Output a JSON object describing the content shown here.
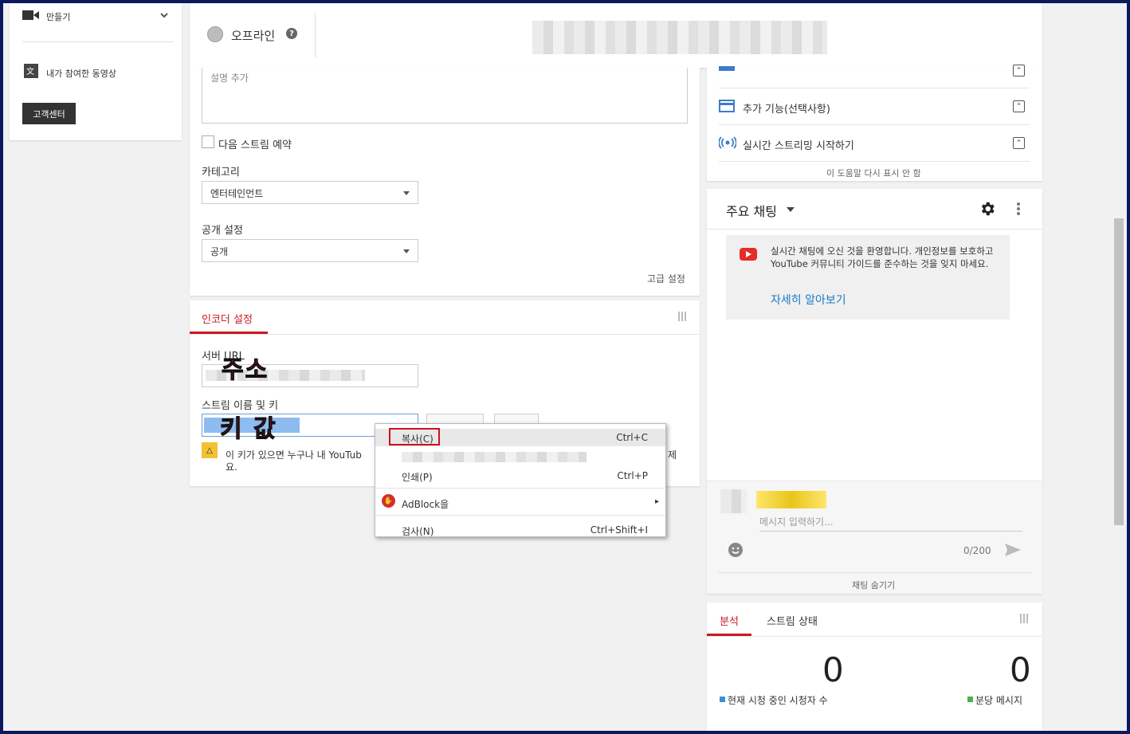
{
  "sidebar": {
    "create_label": "만들기",
    "contributed_label": "내가 참여한 동영상",
    "support_button": "고객센터"
  },
  "topbar": {
    "status": "오프라인",
    "help_icon": "?"
  },
  "info": {
    "description_placeholder": "설명 추가",
    "schedule_next_stream": "다음 스트림 예약",
    "category_label": "카테고리",
    "category_value": "엔터테인먼트",
    "privacy_label": "공개 설정",
    "privacy_value": "공개",
    "advanced_settings": "고급 설정"
  },
  "encoder": {
    "tab": "인코더 설정",
    "server_url_label": "서버 URL",
    "stream_key_label": "스트림 이름 및 키",
    "warning_line1": "이 키가 있으면 누구나 내 YouTub",
    "warning_line2": "요.",
    "warning_tail": "제",
    "overlay_address": "주소",
    "overlay_key": "키 값"
  },
  "context_menu": {
    "items": [
      {
        "label": "복사(C)",
        "shortcut": "Ctrl+C"
      },
      {
        "label": "인쇄(P)",
        "shortcut": "Ctrl+P"
      },
      {
        "label": "AdBlock을",
        "shortcut": "▸"
      },
      {
        "label": "검사(N)",
        "shortcut": "Ctrl+Shift+I"
      }
    ]
  },
  "help_panel": {
    "rows": [
      {
        "label": "추가 기능(선택사항)",
        "icon": "card-icon"
      },
      {
        "label": "실시간 스트리밍 시작하기",
        "icon": "broadcast-icon"
      }
    ],
    "dismiss": "이 도움말 다시 표시 안 함"
  },
  "chat": {
    "title": "주요 채팅",
    "welcome_text": "실시간 채팅에 오신 것을 환영합니다. 개인정보를 보호하고 YouTube 커뮤니티 가이드를 준수하는 것을 잊지 마세요.",
    "learn_more": "자세히 알아보기",
    "input_placeholder": "메시지 입력하기...",
    "counter": "0/200",
    "hide_chat": "채팅 숨기기"
  },
  "stats": {
    "tabs": [
      "분석",
      "스트림 상태"
    ],
    "concurrent_value": "0",
    "concurrent_label": "현재 시청 중인 시청자 수",
    "per_minute_value": "0",
    "per_minute_label": "분당 메시지",
    "concurrent_color": "#3e8fd6",
    "per_minute_color": "#4caf50"
  },
  "colors": {
    "accent_red": "#cc181e",
    "link_blue": "#167ac6",
    "annotation_red": "#d10f1c"
  }
}
